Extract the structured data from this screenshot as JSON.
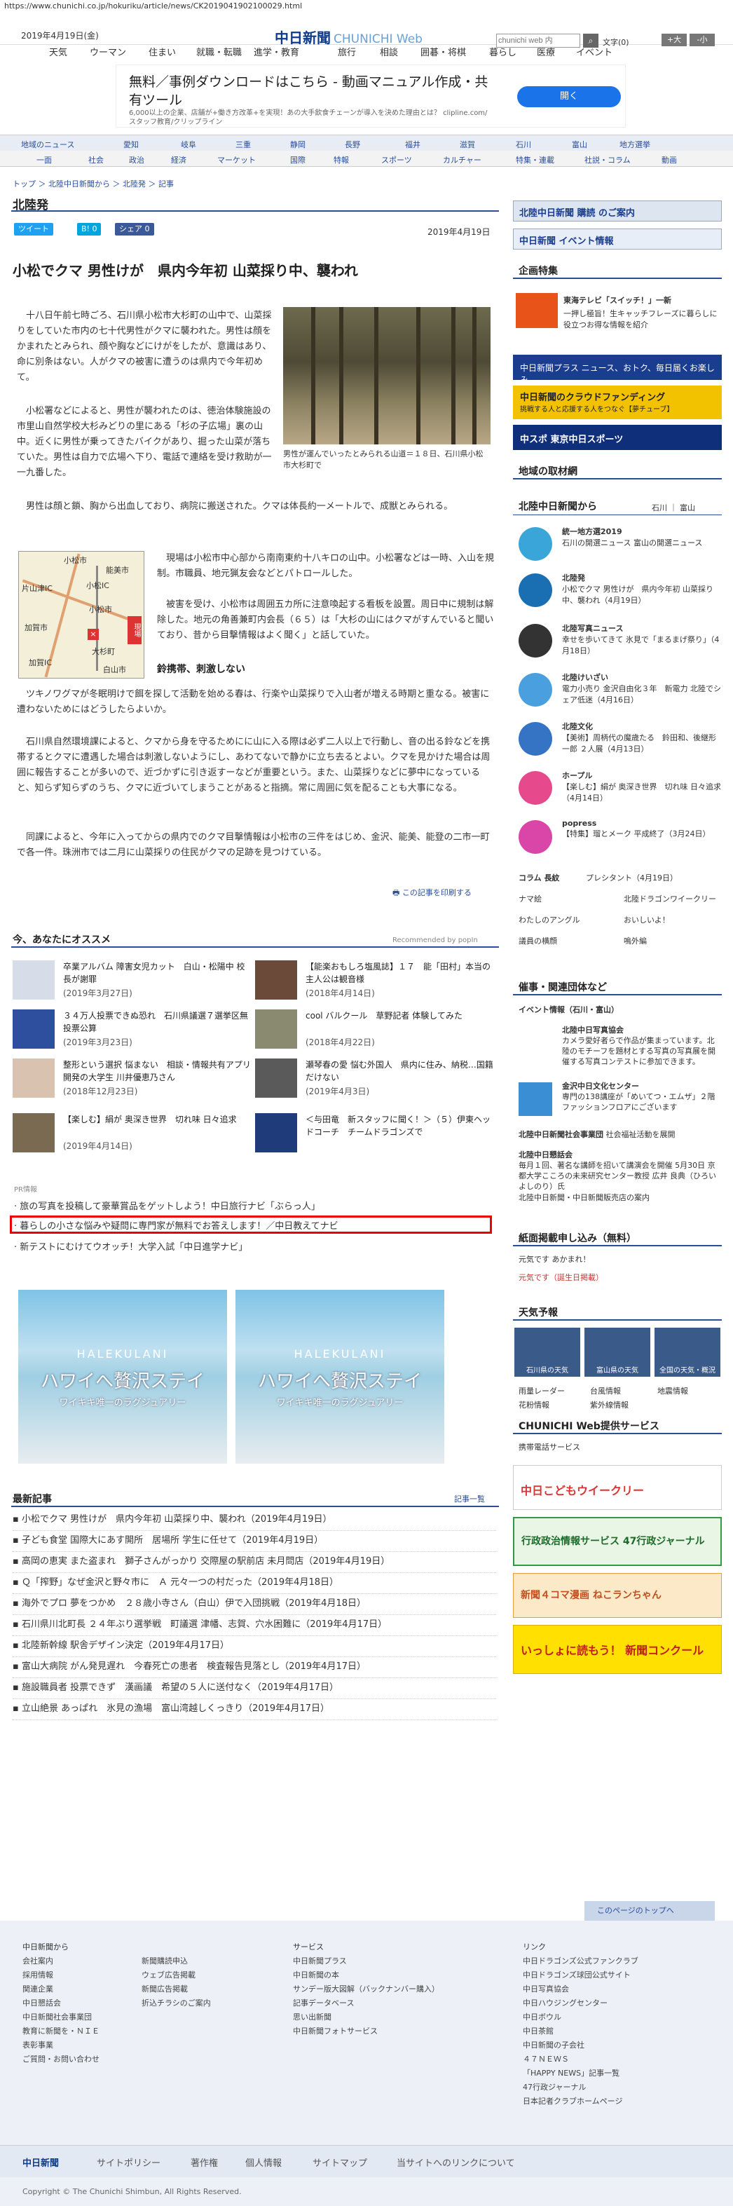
{
  "url": "https://www.chunichi.co.jp/hokuriku/article/news/CK2019041902100029.html",
  "header": {
    "date": "2019年4月19日(金)",
    "logo": "中日新聞",
    "logo_sub": "CHUNICHI Web",
    "search_placeholder": "chunichi web 内",
    "font_label": "文字",
    "font_size": "(0)",
    "font_plus": "+大",
    "font_minus": "-小"
  },
  "topnav": [
    "天気",
    "ウーマン",
    "住まい",
    "就職・転職",
    "進学・教育",
    "旅行",
    "相談",
    "囲碁・将棋",
    "暮らし",
    "医療",
    "イベント"
  ],
  "ad": {
    "title": "無料／事例ダウンロードはこちら - 動画マニュアル作成・共有ツール",
    "desc": "6,000以上の企業、店舗が+働き方改革+を実現！あの大手飲食チェーンが導入を決めた理由とは？ clipline.com/スタッフ教育/クリップライン",
    "button": "開く"
  },
  "cat1": [
    "地域のニュース",
    "愛知",
    "岐阜",
    "三重",
    "静岡",
    "長野",
    "福井",
    "滋賀",
    "石川",
    "富山",
    "地方選挙"
  ],
  "cat2": [
    "一面",
    "社会",
    "政治",
    "経済",
    "マーケット",
    "国際",
    "特報",
    "スポーツ",
    "カルチャー",
    "特集・連載",
    "社説・コラム",
    "動画"
  ],
  "breadcrumb": "トップ ＞ 北陸中日新聞から ＞ 北陸発 ＞ 記事",
  "section": "北陸発",
  "share": {
    "tweet": "ツイート",
    "hatena": "B! 0",
    "fb": "シェア 0"
  },
  "pubdate": "2019年4月19日",
  "article": {
    "title": "小松でクマ 男性けが　県内今年初 山菜採り中、襲われ",
    "p1": "　十八日午前七時ごろ、石川県小松市大杉町の山中で、山菜採りをしていた市内の七十代男性がクマに襲われた。男性は顔をかまれたとみられ、顔や胸などにけがをしたが、意識はあり、命に別条はない。人がクマの被害に遭うのは県内で今年初めて。",
    "p2": "　小松署などによると、男性が襲われたのは、徳治体験施設の市里山自然学校大杉みどりの里にある「杉の子広場」裏の山中。近くに男性が乗ってきたバイクがあり、掘った山菜が落ちていた。男性は自力で広場へ下り、電話で連絡を受け救助が一一九番した。",
    "p3": "　男性は顔と鎖、胸から出血しており、病院に搬送された。クマは体長約一メートルで、成獣とみられる。",
    "p4": "　現場は小松市中心部から南南東約十八キロの山中。小松署などは一時、入山を規制。市職員、地元猟友会などとパトロールした。",
    "p5": "　被害を受け、小松市は周囲五カ所に注意喚起する看板を設置。周日中に規制は解除した。地元の角善兼町内会長（６５）は「大杉の山にはクマがすんでいると聞いており、昔から目撃情報はよく聞く」と話していた。",
    "subhead": "鈴携帯、刺激しない",
    "p6": "　ツキノワグマが冬眠明けで餌を探して活動を始める春は、行楽や山菜採りで入山者が増える時期と重なる。被害に遭わないためにはどうしたらよいか。",
    "p7": "　石川県自然環境課によると、クマから身を守るためにに山に入る際は必ず二人以上で行動し、音の出る鈴などを携帯するとクマに遭遇した場合は刺激しないようにし、あわてないで静かに立ち去るとよい。クマを見かけた場合は周囲に報告することが多いので、近づかずに引き返すーなどが重要という。また、山菜採りなどに夢中になっていると、知らず知らずのうち、クマに近づいてしまうことがあると指摘。常に周囲に気を配ることも大事になる。",
    "p8": "　同課によると、今年に入ってからの県内でのクマ目撃情報は小松市の三件をはじめ、金沢、能美、能登の二市一町で各一件。珠洲市では二月に山菜採りの住民がクマの足跡を見つけている。",
    "caption": "男性が運んでいったとみられる山道＝１８日、石川県小松市大杉町で",
    "map": {
      "city": "小松市",
      "pin": "現場",
      "labels": [
        "片山津IC",
        "小松IC",
        "加賀市",
        "小松市",
        "大杉町",
        "能美市",
        "白山市",
        "加賀IC"
      ]
    },
    "print": "この記事を印刷する"
  },
  "reco": {
    "title": "今、あなたにオススメ",
    "by": "Recommended by popIn",
    "items": [
      {
        "title": "卒業アルバム 障害女児カット　白山・松陽中 校長が謝罪",
        "date": "(2019年3月27日)"
      },
      {
        "title": "【能楽おもしろ塩風誌】１７　能「田村」本当の主人公は観音様",
        "date": "(2018年4月14日)"
      },
      {
        "title": "３４万人投票できぬ恐れ　石川県議選７選挙区無投票公算",
        "date": "(2019年3月23日)"
      },
      {
        "title": "cool バルクール　草野記者 体験してみた",
        "date": "(2018年4月22日)"
      },
      {
        "title": "整形という選択 悩まない　相談・情報共有アプリ開発の大学生 川井優恵乃さん",
        "date": "(2018年12月23日)"
      },
      {
        "title": "瀬琴春の愛 悩む外国人　県内に住み、納税…国籍だけない",
        "date": "(2019年4月3日)"
      },
      {
        "title": "【楽しむ】絹が 奥深き世界　切れ味 日々追求",
        "date": "(2019年4月14日)"
      },
      {
        "title": "＜与田竜　新スタッフに聞く！＞（５）伊東ヘッドコーチ　チームドラゴンズで",
        "date": ""
      }
    ]
  },
  "pr": {
    "label": "PR情報",
    "links": [
      "旅の写真を投稿して豪華賞品をゲットしよう！中日旅行ナビ「ぶらっ人」",
      "暮らしの小さな悩みや疑問に専門家が無料でお答えします！／中日教えてナビ",
      "新テストにむけてウオッチ！大学入試「中日進学ナビ」"
    ]
  },
  "banner": {
    "brand": "HALEKULANI",
    "title": "ハワイへ贅沢ステイ",
    "sub": "ワイキキ唯一のラグジュアリー"
  },
  "recent": {
    "title": "最新記事",
    "more": "記事一覧",
    "items": [
      "小松でクマ 男性けが　県内今年初 山菜採り中、襲われ（2019年4月19日）",
      "子ども食堂 国際大にあす開所　居場所 学生に任せて（2019年4月19日）",
      "高岡の恵実 また盗まれ　獅子さんがっかり 交際屋の駅前店 未月問店（2019年4月19日）",
      "Ｑ「搾野」なぜ金沢と野々市に　Ａ 元々一つの村だった（2019年4月18日）",
      "海外でプロ 夢をつかめ　２８歳小寺さん（白山）伊で入団挑戦（2019年4月18日）",
      "石川県川北町長 ２４年ぶり選挙戦　町議選 津幡、志賀、穴水困難に（2019年4月17日）",
      "北陸新幹線 駅舎デザイン決定（2019年4月17日）",
      "富山大病院 がん発見遅れ　今春死亡の患者　検査報告見落とし（2019年4月17日）",
      "施設職員者 投票できず　漢画議　希望の５人に送付なく（2019年4月17日）",
      "立山絶景 あっぱれ　氷見の漁場　富山湾越しくっきり（2019年4月17日）"
    ]
  },
  "side": {
    "subscribe": "北陸中日新聞 購読 のご案内",
    "event": "中日新聞 イベント情報",
    "kikaku": "企画特集",
    "sw_title": "東海テレビ「スイッチ！」一新",
    "sw_desc": "一押し極旨！生キャッチフレーズに暮らしに役立つお得な情報を紹介",
    "plus": "中日新聞プラス ニュース、おトク、毎日届くお楽しみ",
    "fund": "中日新聞のクラウドファンディング",
    "fund2": "挑戦する人と応援する人をつなぐ【夢チューブ】",
    "spo": "中スポ 東京中日スポーツ",
    "chiiki": "地域の取材網",
    "hokuriku": "北陸中日新聞から",
    "areas": "石川 ｜ 富山",
    "items": [
      {
        "title": "統一地方選2019",
        "desc": "石川の開選ニュース 富山の開選ニュース"
      },
      {
        "title": "北陸発",
        "desc": "小松でクマ 男性けが　県内今年初 山菜採り中、襲われ（4月19日）"
      },
      {
        "title": "北陸写真ニュース",
        "desc": "幸せを歩いてきて 氷見で「まるまげ祭り」（4月18日）"
      },
      {
        "title": "北陸けいざい",
        "desc": "電力小売り 金沢自由化３年　新電力 北陸でシェア低迷（4月16日）"
      },
      {
        "title": "北陸文化",
        "desc": "【美術】周柄代の魔歳たる　鈴田和、後継形一郎 ２人展（4月13日）"
      },
      {
        "title": "ホープル",
        "desc": "【楽しむ】絹が 奥深き世界　切れ味 日々追求（4月14日）"
      },
      {
        "title": "popress",
        "desc": "【特集】瑠とメーク 平成終了（3月24日）"
      }
    ],
    "column": "コラム 長紋",
    "bs": "プレシタント（4月19日）",
    "cols": [
      "ナマ絵",
      "北陸ドラゴンワイークリー",
      "わたしのアングル",
      "おいしいよ！",
      "議員の横顔",
      "嗚外編"
    ],
    "kanren": "催事・関連団体など",
    "event2": "イベント情報（石川・富山）",
    "org1": "北陸中日写真協会",
    "org1d": "カメラ愛好者らで作品が集まっています。北陸のモチーフを題材とする写真の写真展を開催する写真コンテストに参加できます。",
    "org2": "金沢中日文化センター",
    "org2d": "専門の138講座が「めいてつ・エムザ」２階ファッションフロアにございます",
    "org3": "北陸中日新聞社会事業団",
    "org3d": "社会福祉活動を展開",
    "org4": "北陸中日懇話会",
    "org4d": "毎月１回、著名な講師を招いて講演会を開催 5月30日 京都大学こころの未来研究センター教授 広井 良典（ひろい よしのり）氏",
    "org5": "北陸中日新聞・中日新聞販売店の案内",
    "shimen": "紙面掲載申し込み（無料）",
    "s1": "元気です あかまれ！",
    "s2": "元気です（誕生日掲載）",
    "weather": "天気予報",
    "w": [
      "石川県の天気",
      "富山県の天気",
      "全国の天気・概況"
    ],
    "wlinks": [
      "雨量レーダー",
      "台風情報",
      "地震情報",
      "花粉情報",
      "紫外線情報"
    ],
    "service": "CHUNICHI Web提供サービス",
    "svc1": "携帯電話サービス",
    "kodomo": "中日こどもウイークリー",
    "gyosei": "行政政治情報サービス 47行政ジャーナル",
    "wan": "新聞４コマ漫画 ねこランちゃん",
    "concours": "いっしょに読もう！ 新聞コンクール"
  },
  "footer": {
    "col1": [
      "中日新聞から",
      "会社案内",
      "採用情報",
      "関連企業",
      "中日懇話会",
      "中日新聞社会事業団",
      "教育に新聞を・ＮＩＥ",
      "表彰事業",
      "ご質問・お問い合わせ"
    ],
    "col2": [
      "",
      "新聞購読申込",
      "ウェブ広告掲載",
      "新聞広告掲載",
      "折込チラシのご案内"
    ],
    "col3": [
      "サービス",
      "中日新聞プラス",
      "中日新聞の本",
      "サンデー版大図解（バックナンバー購入）",
      "記事データベース",
      "思い出新聞",
      "中日新聞フォトサービス"
    ],
    "col4": [
      "リンク",
      "中日ドラゴンズ公式ファンクラブ",
      "中日ドラゴンズ球団公式サイト",
      "中日写真協会",
      "中日ハウジングセンター",
      "中日ボウル",
      "中日茶館",
      "中日新聞の子会社",
      "４７ＮＥＷＳ",
      "「HAPPY NEWS」記事一覧",
      "47行政ジャーナル",
      "日本記者クラブホームページ"
    ],
    "totop": "このページのトップへ",
    "bar": [
      "中日新聞",
      "サイトポリシー",
      "著作権",
      "個人情報",
      "サイトマップ",
      "当サイトへのリンクについて"
    ],
    "copy": "Copyright © The Chunichi Shimbun, All Rights Reserved."
  }
}
